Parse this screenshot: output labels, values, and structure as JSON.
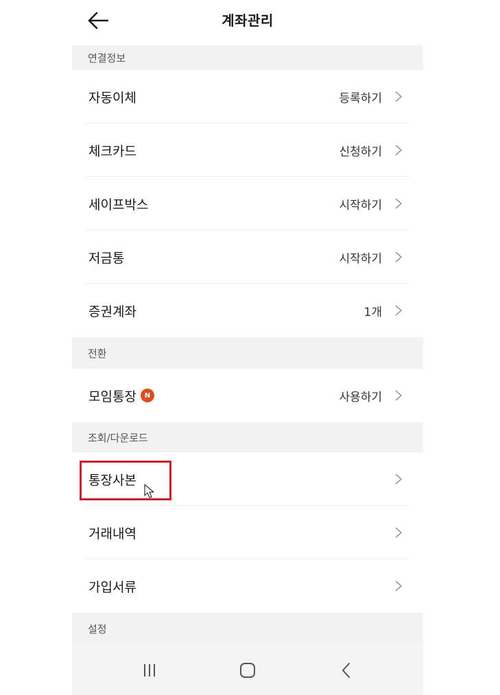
{
  "header": {
    "title": "계좌관리"
  },
  "sections": {
    "linked": "연결정보",
    "convert": "전환",
    "view_download": "조회/다운로드",
    "settings": "설정"
  },
  "rows": {
    "auto_transfer": {
      "label": "자동이체",
      "value": "등록하기"
    },
    "check_card": {
      "label": "체크카드",
      "value": "신청하기"
    },
    "safe_box": {
      "label": "세이프박스",
      "value": "시작하기"
    },
    "savings_box": {
      "label": "저금통",
      "value": "시작하기"
    },
    "securities": {
      "label": "증권계좌",
      "value": "1개"
    },
    "group_account": {
      "label": "모임통장",
      "badge": "N",
      "value": "사용하기"
    },
    "bankbook_copy": {
      "label": "통장사본"
    },
    "transactions": {
      "label": "거래내역"
    },
    "signup_docs": {
      "label": "가입서류"
    }
  },
  "colors": {
    "accent_badge": "#d9501f",
    "highlight": "#c8202b",
    "section_bg": "#f2f2f2"
  },
  "icons": {
    "back": "back-arrow-icon",
    "chevron": "chevron-right-icon",
    "nav_recent": "recent-apps-icon",
    "nav_home": "home-icon",
    "nav_back": "nav-back-icon"
  }
}
